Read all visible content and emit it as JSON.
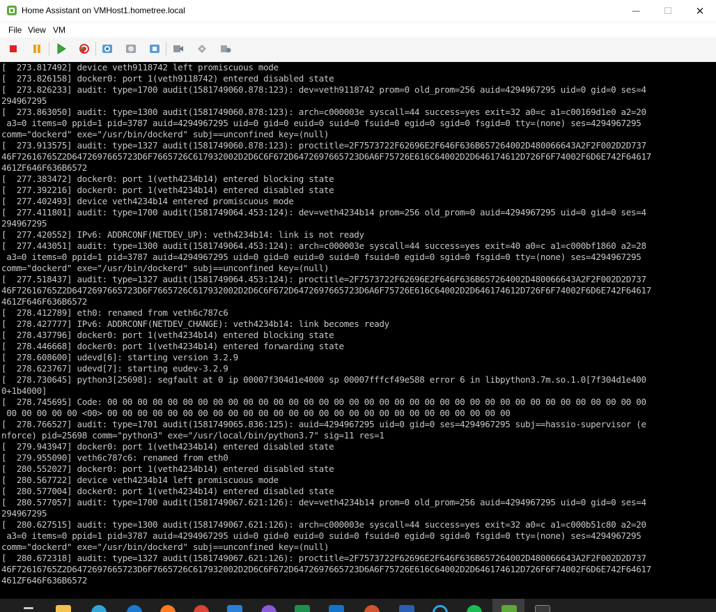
{
  "window": {
    "title": "Home Assistant on VMHost1.hometree.local",
    "controls": {
      "minimize": "—",
      "maximize": "☐",
      "close": "✕"
    }
  },
  "menu": {
    "file": "File",
    "view": "View",
    "vm": "VM"
  },
  "toolbar": {
    "buttons": [
      "stop-icon",
      "pause-icon",
      "play-icon",
      "reset-icon",
      "snapshot-icon",
      "revert-icon",
      "manage-snapshots-icon",
      "enhanced-session-icon",
      "share-icon",
      "settings-icon"
    ]
  },
  "console": {
    "lines": [
      "[  273.817492] device veth9118742 left promiscuous mode",
      "[  273.826158] docker0: port 1(veth9118742) entered disabled state",
      "[  273.826233] audit: type=1700 audit(1581749060.878:123): dev=veth9118742 prom=0 old_prom=256 auid=4294967295 uid=0 gid=0 ses=4",
      "294967295",
      "[  273.863050] audit: type=1300 audit(1581749060.878:123): arch=c000003e syscall=44 success=yes exit=32 a0=c a1=c00169d1e0 a2=20",
      " a3=0 items=0 ppid=1 pid=3787 auid=4294967295 uid=0 gid=0 euid=0 suid=0 fsuid=0 egid=0 sgid=0 fsgid=0 tty=(none) ses=4294967295",
      "comm=\"dockerd\" exe=\"/usr/bin/dockerd\" subj==unconfined key=(null)",
      "[  273.913575] audit: type=1327 audit(1581749060.878:123): proctitle=2F7573722F62696E2F646F636B657264002D480066643A2F2F002D2D737",
      "46F72616765Z2D6472697665723D6F7665726C617932002D2D6C6F672D6472697665723D6A6F75726E616C64002D2D646174612D726F6F74002F6D6E742F64617",
      "461ZF646F636B6572",
      "[  277.383472] docker0: port 1(veth4234b14) entered blocking state",
      "[  277.392216] docker0: port 1(veth4234b14) entered disabled state",
      "[  277.402493] device veth4234b14 entered promiscuous mode",
      "[  277.411801] audit: type=1700 audit(1581749064.453:124): dev=veth4234b14 prom=256 old_prom=0 auid=4294967295 uid=0 gid=0 ses=4",
      "294967295",
      "[  277.420552] IPv6: ADDRCONF(NETDEV_UP): veth4234b14: link is not ready",
      "[  277.443051] audit: type=1300 audit(1581749064.453:124): arch=c000003e syscall=44 success=yes exit=40 a0=c a1=c000bf1860 a2=28",
      " a3=0 items=0 ppid=1 pid=3787 auid=4294967295 uid=0 gid=0 euid=0 suid=0 fsuid=0 egid=0 sgid=0 fsgid=0 tty=(none) ses=4294967295",
      "comm=\"dockerd\" exe=\"/usr/bin/dockerd\" subj==unconfined key=(null)",
      "[  277.518437] audit: type=1327 audit(1581749064.453:124): proctitle=2F7573722F62696E2F646F636B657264002D480066643A2F2F002D2D737",
      "46F72616765Z2D6472697665723D6F7665726C617932002D2D6C6F672D6472697665723D6A6F75726E616C64002D2D646174612D726F6F74002F6D6E742F64617",
      "461ZF646F636B6572",
      "[  278.412789] eth0: renamed from veth6c787c6",
      "[  278.427777] IPv6: ADDRCONF(NETDEV_CHANGE): veth4234b14: link becomes ready",
      "[  278.437796] docker0: port 1(veth4234b14) entered blocking state",
      "[  278.446668] docker0: port 1(veth4234b14) entered forwarding state",
      "[  278.608600] udevd[6]: starting version 3.2.9",
      "[  278.623767] udevd[7]: starting eudev-3.2.9",
      "[  278.730645] python3[25698]: segfault at 0 ip 00007f304d1e4000 sp 00007fffcf49e588 error 6 in libpython3.7m.so.1.0[7f304d1e400",
      "0+1b4000]",
      "[  278.745695] Code: 00 00 00 00 00 00 00 00 00 00 00 00 00 00 00 00 00 00 00 00 00 00 00 00 00 00 00 00 00 00 00 00 00 00 00 00",
      " 00 00 00 00 00 <00> 00 00 00 00 00 00 00 00 00 00 00 00 00 00 00 00 00 00 00 00 00 00 00 00 00 00 00",
      "[  278.766527] audit: type=1701 audit(1581749065.836:125): auid=4294967295 uid=0 gid=0 ses=4294967295 subj==hassio-supervisor (e",
      "nforce) pid=25698 comm=\"python3\" exe=\"/usr/local/bin/python3.7\" sig=11 res=1",
      "[  279.943947] docker0: port 1(veth4234b14) entered disabled state",
      "[  279.955090] veth6c787c6: renamed from eth0",
      "[  280.552027] docker0: port 1(veth4234b14) entered disabled state",
      "[  280.567722] device veth4234b14 left promiscuous mode",
      "[  280.577004] docker0: port 1(veth4234b14) entered disabled state",
      "[  280.577057] audit: type=1700 audit(1581749067.621:126): dev=veth4234b14 prom=0 old_prom=256 auid=4294967295 uid=0 gid=0 ses=4",
      "294967295",
      "[  280.627515] audit: type=1300 audit(1581749067.621:126): arch=c000003e syscall=44 success=yes exit=32 a0=c a1=c000b51c80 a2=20",
      " a3=0 items=0 ppid=1 pid=3787 auid=4294967295 uid=0 gid=0 euid=0 suid=0 fsuid=0 egid=0 sgid=0 fsgid=0 tty=(none) ses=4294967295",
      "comm=\"dockerd\" exe=\"/usr/bin/dockerd\" subj==unconfined key=(null)",
      "[  280.672318] audit: type=1327 audit(1581749067.621:126): proctitle=2F7573722F62696E2F646F636B657264002D480066643A2F2F002D2D737",
      "46F72616765Z2D6472697665723D6F7665726C617932002D2D6C6F672D6472697665723D6A6F75726E616C64002D2D646174612D726F6F74002F6D6E742F64617",
      "461ZF646F636B6572"
    ]
  },
  "colors": {
    "console_bg": "#000000",
    "console_text": "#c6c6c6",
    "taskbar_bg": "#1f1f1f"
  },
  "taskbar": {
    "icons": [
      "task-view-icon",
      "file-explorer-icon",
      "edge-icon",
      "edge-dev-icon",
      "firefox-icon",
      "chrome-icon",
      "vscode-icon",
      "visual-studio-icon",
      "excel-icon",
      "outlook-icon",
      "powerpoint-icon",
      "word-icon",
      "cortana-icon",
      "spotify-icon",
      "hyper-v-icon",
      "terminal-icon"
    ]
  }
}
